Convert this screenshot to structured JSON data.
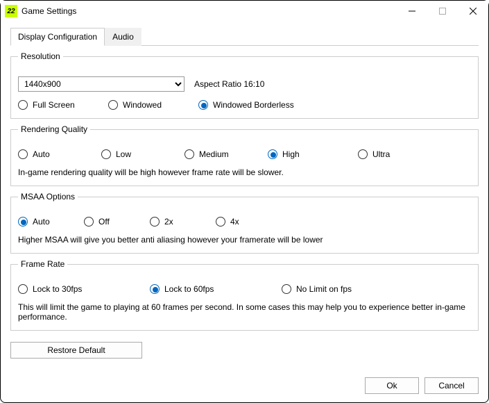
{
  "window": {
    "title": "Game Settings",
    "icon_text": "22"
  },
  "tabs": {
    "display": "Display Configuration",
    "audio": "Audio"
  },
  "resolution": {
    "legend": "Resolution",
    "selected": "1440x900",
    "aspect_label": "Aspect Ratio 16:10",
    "modes": {
      "full": "Full Screen",
      "windowed": "Windowed",
      "borderless": "Windowed Borderless"
    }
  },
  "quality": {
    "legend": "Rendering Quality",
    "opts": {
      "auto": "Auto",
      "low": "Low",
      "medium": "Medium",
      "high": "High",
      "ultra": "Ultra"
    },
    "desc": "In-game rendering quality will be high however frame rate will be slower."
  },
  "msaa": {
    "legend": "MSAA Options",
    "opts": {
      "auto": "Auto",
      "off": "Off",
      "x2": "2x",
      "x4": "4x"
    },
    "desc": "Higher MSAA will give you better anti aliasing however your framerate will be lower"
  },
  "fps": {
    "legend": "Frame Rate",
    "opts": {
      "lock30": "Lock  to 30fps",
      "lock60": "Lock to 60fps",
      "nolimit": "No Limit on fps"
    },
    "desc": "This will limit the game to playing at 60 frames per second. In some cases this may help you to experience better in-game performance."
  },
  "buttons": {
    "restore": "Restore Default",
    "ok": "Ok",
    "cancel": "Cancel"
  }
}
